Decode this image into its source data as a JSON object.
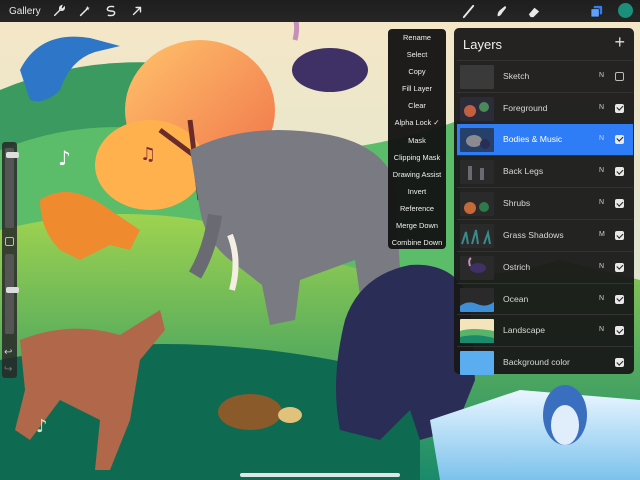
{
  "topbar": {
    "gallery_label": "Gallery",
    "left_tools": [
      "wrench-icon",
      "magic-wand-icon",
      "selection-icon",
      "transform-icon"
    ],
    "right_tools": [
      "brush-icon",
      "smudge-icon",
      "eraser-icon",
      "layers-icon"
    ],
    "active_color": "#1a8f7a"
  },
  "sidebar": {
    "brush_size_level": 0.06,
    "opacity_level": 0.45
  },
  "layer_menu": {
    "items": [
      "Rename",
      "Select",
      "Copy",
      "Fill Layer",
      "Clear",
      "Alpha Lock ✓",
      "Mask",
      "Clipping Mask",
      "Drawing Assist",
      "Invert",
      "Reference",
      "Merge Down",
      "Combine Down"
    ]
  },
  "layers_panel": {
    "title": "Layers",
    "layers": [
      {
        "name": "Sketch",
        "mode": "N",
        "visible": false,
        "selected": false,
        "thumb": "sketch"
      },
      {
        "name": "Foreground",
        "mode": "N",
        "visible": true,
        "selected": false,
        "thumb": "foreground"
      },
      {
        "name": "Bodies & Music",
        "mode": "N",
        "visible": true,
        "selected": true,
        "thumb": "bodies"
      },
      {
        "name": "Back Legs",
        "mode": "N",
        "visible": true,
        "selected": false,
        "thumb": "backlegs"
      },
      {
        "name": "Shrubs",
        "mode": "N",
        "visible": true,
        "selected": false,
        "thumb": "shrubs"
      },
      {
        "name": "Grass Shadows",
        "mode": "M",
        "visible": true,
        "selected": false,
        "thumb": "grass"
      },
      {
        "name": "Ostrich",
        "mode": "N",
        "visible": true,
        "selected": false,
        "thumb": "ostrich"
      },
      {
        "name": "Ocean",
        "mode": "N",
        "visible": true,
        "selected": false,
        "thumb": "ocean"
      },
      {
        "name": "Landscape",
        "mode": "N",
        "visible": true,
        "selected": false,
        "thumb": "landscape"
      },
      {
        "name": "Background color",
        "mode": "",
        "visible": true,
        "selected": false,
        "thumb": "bgcolor"
      }
    ]
  },
  "colors": {
    "selected_layer": "#2f7df6",
    "panel_bg": "#181818",
    "background_color_swatch": "#5aaef0"
  }
}
